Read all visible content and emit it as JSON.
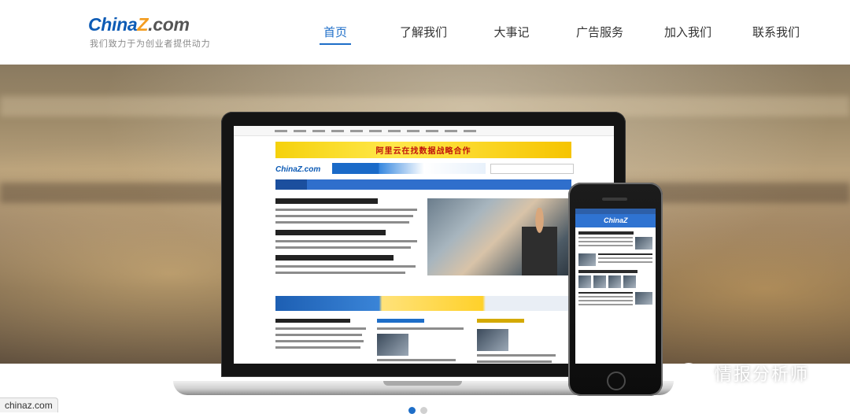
{
  "header": {
    "logo": {
      "brand": "China",
      "z": "Z",
      "dotcom": ".com"
    },
    "tagline": "我们致力于为创业者提供动力",
    "nav": [
      {
        "label": "首页",
        "active": true
      },
      {
        "label": "了解我们",
        "active": false
      },
      {
        "label": "大事记",
        "active": false
      },
      {
        "label": "广告服务",
        "active": false
      },
      {
        "label": "加入我们",
        "active": false
      },
      {
        "label": "联系我们",
        "active": false
      }
    ]
  },
  "hero": {
    "laptop_screen": {
      "site_logo": "ChinaZ.com",
      "ad_banner": "阿里云在找数据战略合作"
    },
    "phone_screen": {
      "app_title": "ChinaZ"
    }
  },
  "watermark": {
    "text": "情报分析师"
  },
  "footer": {
    "url": "chinaz.com",
    "carousel": {
      "count": 2,
      "active_index": 0
    }
  },
  "colors": {
    "accent": "#1e6ec8",
    "brand_blue": "#0d5bb5",
    "brand_orange": "#f39c1f"
  }
}
